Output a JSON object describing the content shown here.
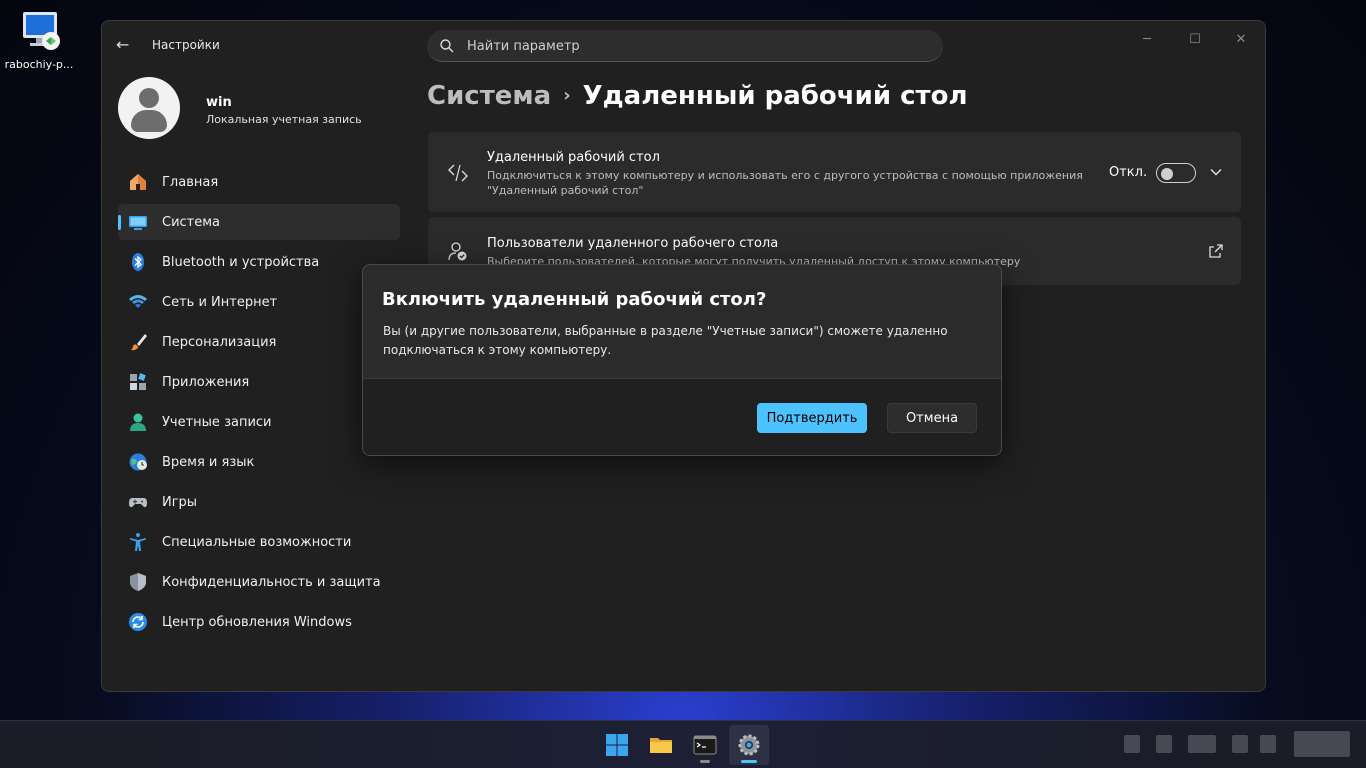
{
  "desktop": {
    "icon_label": "rabochiy-p..."
  },
  "window": {
    "app_title": "Настройки",
    "back_symbol": "←",
    "controls": {
      "minimize": "─",
      "maximize": "☐",
      "close": "✕"
    }
  },
  "search": {
    "placeholder": "Найти параметр"
  },
  "profile": {
    "name": "win",
    "account_type": "Локальная учетная запись"
  },
  "sidebar": {
    "items": [
      {
        "label": "Главная",
        "icon": "home-icon",
        "active": false
      },
      {
        "label": "Система",
        "icon": "system-icon",
        "active": true
      },
      {
        "label": "Bluetooth и устройства",
        "icon": "bluetooth-icon",
        "active": false
      },
      {
        "label": "Сеть и Интернет",
        "icon": "wifi-icon",
        "active": false
      },
      {
        "label": "Персонализация",
        "icon": "brush-icon",
        "active": false
      },
      {
        "label": "Приложения",
        "icon": "apps-icon",
        "active": false
      },
      {
        "label": "Учетные записи",
        "icon": "accounts-icon",
        "active": false
      },
      {
        "label": "Время и язык",
        "icon": "time-language-icon",
        "active": false
      },
      {
        "label": "Игры",
        "icon": "gamepad-icon",
        "active": false
      },
      {
        "label": "Специальные возможности",
        "icon": "accessibility-icon",
        "active": false
      },
      {
        "label": "Конфиденциальность и защита",
        "icon": "shield-icon",
        "active": false
      },
      {
        "label": "Центр обновления Windows",
        "icon": "update-icon",
        "active": false
      }
    ]
  },
  "breadcrumb": {
    "parent": "Система",
    "separator": "›",
    "current": "Удаленный рабочий стол"
  },
  "cards": {
    "remote_desktop": {
      "title": "Удаленный рабочий стол",
      "description": "Подключиться к этому компьютеру и использовать его с другого устройства с помощью приложения \"Удаленный рабочий стол\"",
      "toggle_label": "Откл.",
      "toggle_on": false
    },
    "remote_users": {
      "title": "Пользователи удаленного рабочего стола",
      "description": "Выберите пользователей, которые могут получить удаленный доступ к этому компьютеру"
    }
  },
  "dialog": {
    "title": "Включить удаленный рабочий стол?",
    "body": "Вы (и другие пользователи, выбранные в разделе \"Учетные записи\") сможете удаленно подключаться к этому компьютеру.",
    "confirm_label": "Подтвердить",
    "cancel_label": "Отмена"
  },
  "taskbar": {
    "items": [
      "start-icon",
      "file-explorer-icon",
      "terminal-icon",
      "settings-icon"
    ],
    "active_item": "settings-icon"
  },
  "colors": {
    "accent": "#4cc2ff",
    "window_bg": "#202020",
    "card_bg": "#2b2b2b"
  }
}
